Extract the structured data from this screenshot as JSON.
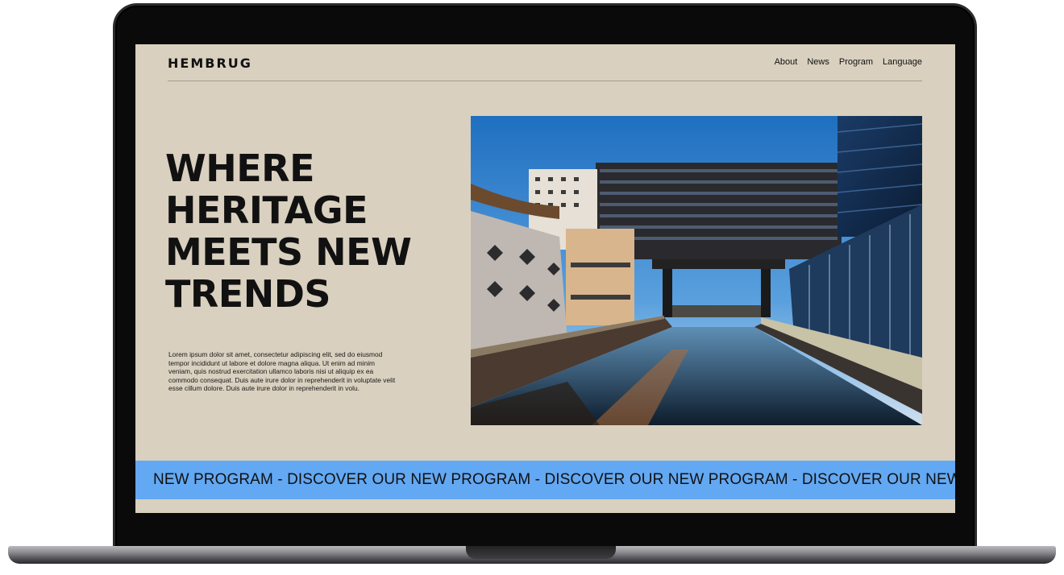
{
  "site": {
    "logo": "HEMBRUG",
    "nav": [
      "About",
      "News",
      "Program",
      "Language"
    ]
  },
  "hero": {
    "title_lines": [
      "WHERE",
      "HERITAGE",
      "MEETS NEW",
      "TRENDS"
    ],
    "body": "Lorem ipsum dolor sit amet, consectetur adipiscing elit, sed do eiusmod tempor incididunt ut labore et dolore magna aliqua. Ut enim ad minim veniam, quis nostrud exercitation ullamco laboris nisi ut aliquip ex ea commodo consequat. Duis aute irure dolor in reprehenderit in voluptate velit esse cillum dolore. Duis aute irure dolor in reprehenderit in volu."
  },
  "ticker": {
    "text": "NEW PROGRAM - DISCOVER OUR NEW PROGRAM - DISCOVER OUR NEW PROGRAM - DISCOVER OUR NEW P"
  },
  "colors": {
    "background": "#d9d0bf",
    "ticker": "#63a8f2",
    "text": "#111111"
  }
}
